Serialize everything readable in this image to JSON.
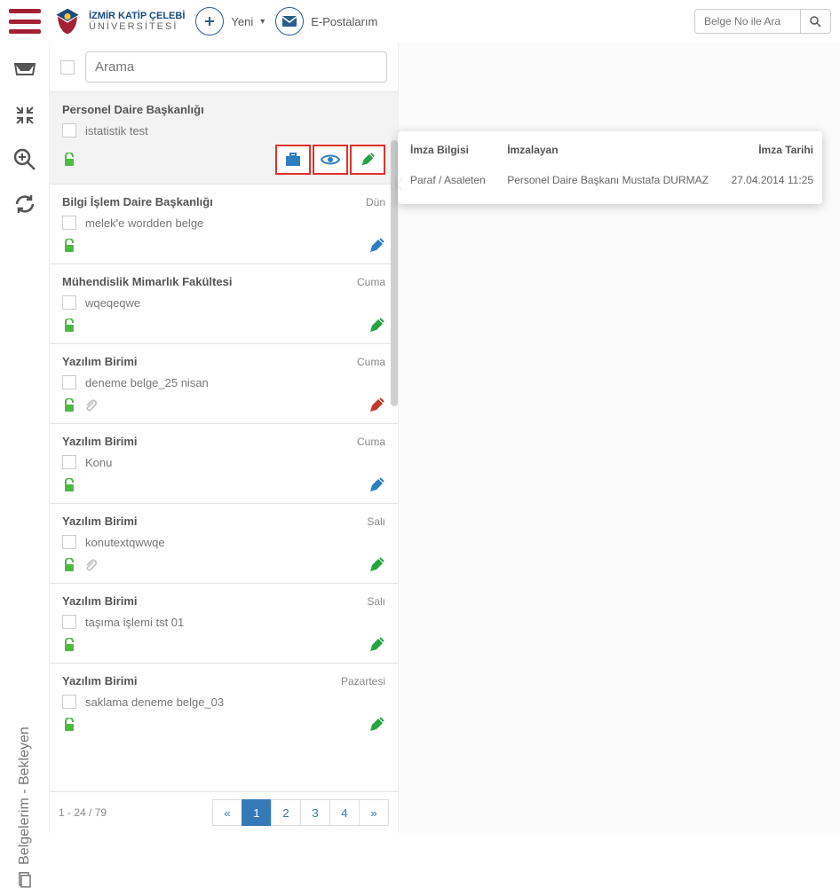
{
  "header": {
    "university_name": "İZMİR KATİP ÇELEBİ",
    "university_sub": "ÜNİVERSİTESİ",
    "new_label": "Yeni",
    "emails_label": "E-Postalarım",
    "search_placeholder": "Belge No ile Ara"
  },
  "list": {
    "search_placeholder": "Arama",
    "items": [
      {
        "title": "Personel Daire Başkanlığı",
        "subject": "istatistik test",
        "date": "",
        "pen": "green",
        "clip": false,
        "selected": true,
        "actions": true
      },
      {
        "title": "Bilgi İşlem Daire Başkanlığı",
        "subject": "melek'e wordden belge",
        "date": "Dün",
        "pen": "blue",
        "clip": false,
        "selected": false,
        "actions": false
      },
      {
        "title": "Mühendislik Mimarlık Fakültesi",
        "subject": "wqeqeqwe",
        "date": "Cuma",
        "pen": "green",
        "clip": false,
        "selected": false,
        "actions": false
      },
      {
        "title": "Yazılım Birimi",
        "subject": "deneme belge_25 nisan",
        "date": "Cuma",
        "pen": "red",
        "clip": true,
        "selected": false,
        "actions": false
      },
      {
        "title": "Yazılım Birimi",
        "subject": "Konu",
        "date": "Cuma",
        "pen": "blue",
        "clip": false,
        "selected": false,
        "actions": false
      },
      {
        "title": "Yazılım Birimi",
        "subject": "konutextqwwqe",
        "date": "Salı",
        "pen": "green",
        "clip": true,
        "selected": false,
        "actions": false
      },
      {
        "title": "Yazılım Birimi",
        "subject": "taşıma işlemi tst 01",
        "date": "Salı",
        "pen": "green",
        "clip": false,
        "selected": false,
        "actions": false
      },
      {
        "title": "Yazılım Birimi",
        "subject": "saklama deneme belge_03",
        "date": "Pazartesi",
        "pen": "green",
        "clip": false,
        "selected": false,
        "actions": false
      }
    ]
  },
  "pager": {
    "range": "1 - 24 / 79",
    "pages": [
      "«",
      "1",
      "2",
      "3",
      "4",
      "»"
    ],
    "active": 1
  },
  "tooltip": {
    "col1": "İmza Bilgisi",
    "col2": "İmzalayan",
    "col3": "İmza Tarihi",
    "v1": "Paraf / Asaleten",
    "v2": "Personel Daire Başkanı Mustafa DURMAZ",
    "v3": "27.04.2014 11:25"
  },
  "sidebar_label": "Belgelerim - Bekleyen"
}
